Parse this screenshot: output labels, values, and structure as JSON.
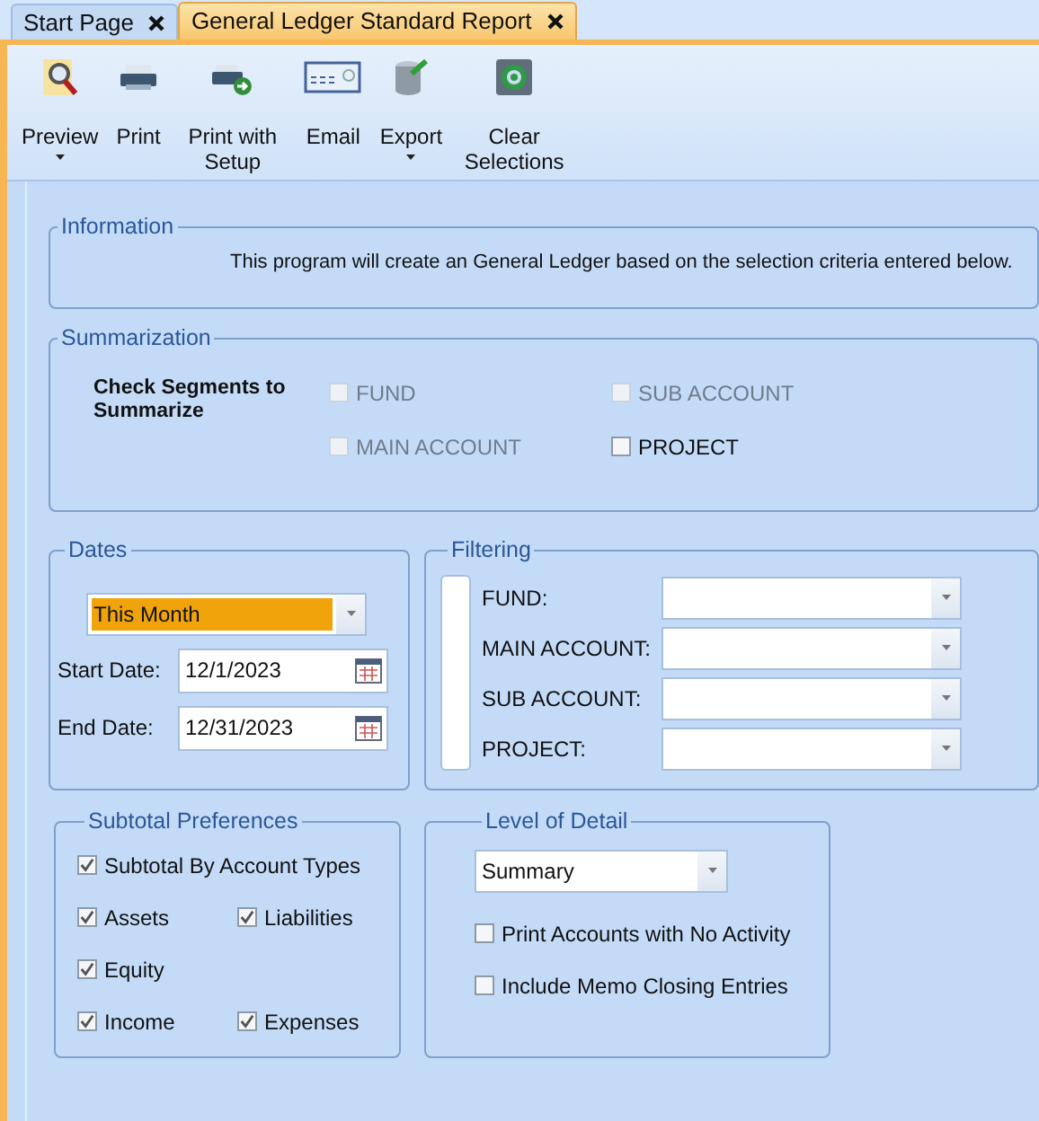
{
  "tabs": [
    {
      "label": "Start Page",
      "selected": false
    },
    {
      "label": "General Ledger Standard Report",
      "selected": true
    }
  ],
  "toolbar": [
    {
      "kind": "preview",
      "label": "Preview",
      "dropdown": true
    },
    {
      "kind": "print",
      "label": "Print",
      "dropdown": false
    },
    {
      "kind": "print_setup",
      "label": "Print with Setup",
      "dropdown": false
    },
    {
      "kind": "email",
      "label": "Email",
      "dropdown": false
    },
    {
      "kind": "export",
      "label": "Export",
      "dropdown": true
    },
    {
      "kind": "clear",
      "label": "Clear Selections",
      "dropdown": false
    }
  ],
  "information": {
    "title": "Information",
    "text": "This program will create an General Ledger based on the selection criteria entered below."
  },
  "summarization": {
    "title": "Summarization",
    "label": "Check Segments to Summarize",
    "options": [
      {
        "label": "FUND",
        "checked": false,
        "disabled": true
      },
      {
        "label": "SUB ACCOUNT",
        "checked": false,
        "disabled": true
      },
      {
        "label": "MAIN ACCOUNT",
        "checked": false,
        "disabled": true
      },
      {
        "label": "PROJECT",
        "checked": false,
        "disabled": false
      }
    ]
  },
  "dates": {
    "title": "Dates",
    "period": {
      "value": "This Month",
      "highlighted": true
    },
    "fields": [
      {
        "label": "Start Date:",
        "value": "12/1/2023"
      },
      {
        "label": "End Date:",
        "value": "12/31/2023"
      }
    ]
  },
  "filtering": {
    "title": "Filtering",
    "fields": [
      {
        "label": "FUND:"
      },
      {
        "label": "MAIN ACCOUNT:"
      },
      {
        "label": "SUB ACCOUNT:"
      },
      {
        "label": "PROJECT:"
      }
    ]
  },
  "subtotal_preferences": {
    "title": "Subtotal Preferences",
    "rows": [
      [
        {
          "label": "Subtotal By Account Types",
          "checked": true
        }
      ],
      [
        {
          "label": "Assets",
          "checked": true
        },
        {
          "label": "Liabilities",
          "checked": true
        }
      ],
      [
        {
          "label": "Equity",
          "checked": true
        }
      ],
      [
        {
          "label": "Income",
          "checked": true
        },
        {
          "label": "Expenses",
          "checked": true
        }
      ]
    ]
  },
  "level_of_detail": {
    "title": "Level of Detail",
    "value": "Summary",
    "options": [
      {
        "label": "Print Accounts with No Activity",
        "checked": false
      },
      {
        "label": "Include Memo Closing Entries",
        "checked": false
      }
    ]
  }
}
